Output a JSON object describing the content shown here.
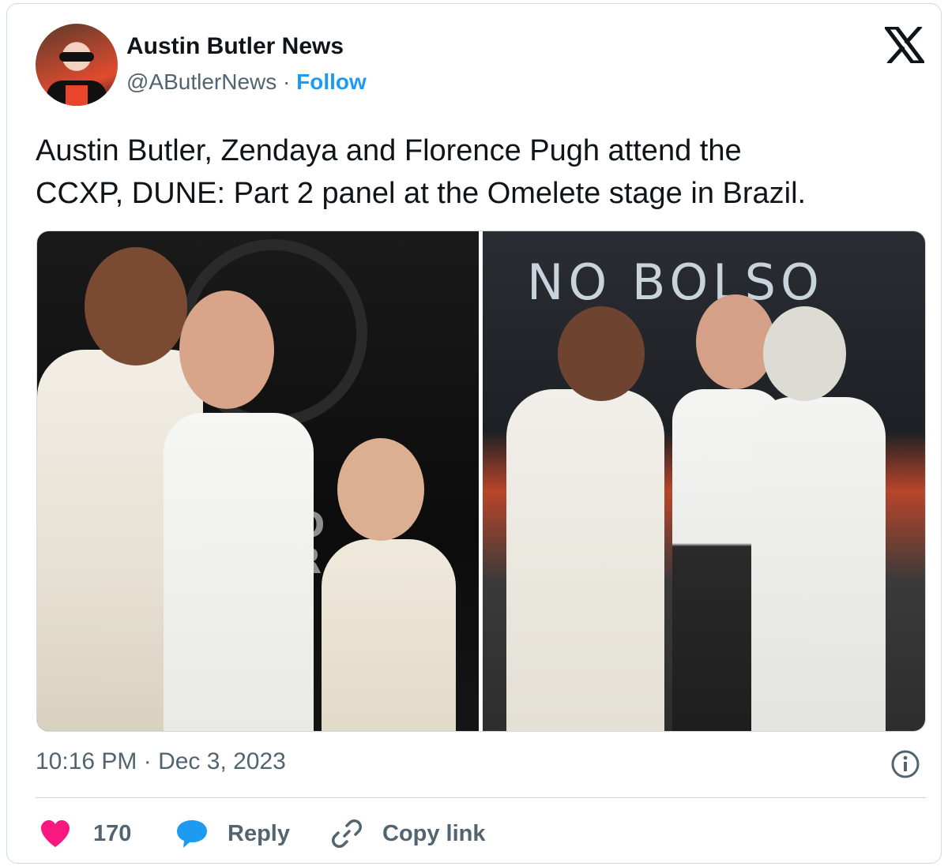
{
  "author": {
    "display_name": "Austin Butler News",
    "handle": "@AButlerNews",
    "separator": "·",
    "follow_label": "Follow"
  },
  "platform_icon": "x-logo-icon",
  "tweet": {
    "text": "Austin Butler, Zendaya and Florence Pugh  attend the\nCCXP, DUNE: Part 2 panel at the Omelete stage in Brazil.",
    "timestamp": "10:16 PM · Dec 3, 2023"
  },
  "media": {
    "photos": [
      {
        "name": "photo-left",
        "side_text": "NO\nGR\nIL"
      },
      {
        "name": "photo-right",
        "banner_text": "NO BOLSO"
      }
    ]
  },
  "actions": {
    "likes_count": "170",
    "reply_label": "Reply",
    "copy_link_label": "Copy link"
  },
  "icons": [
    "x-logo-icon",
    "info-icon",
    "heart-icon",
    "reply-bubble-icon",
    "link-icon"
  ],
  "colors": {
    "follow": "#1d9bf0",
    "heart": "#f91880",
    "reply_bubble": "#1d9bf0",
    "secondary_text": "#536471",
    "primary_text": "#0f1419"
  }
}
